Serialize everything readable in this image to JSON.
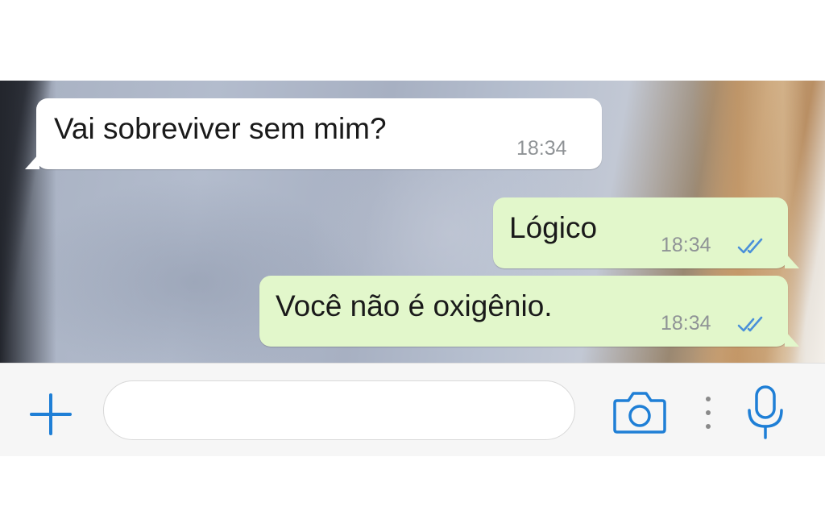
{
  "messages": [
    {
      "direction": "incoming",
      "text": "Vai sobreviver sem mim?",
      "time": "18:34"
    },
    {
      "direction": "outgoing",
      "text": "Lógico",
      "time": "18:34",
      "status": "read"
    },
    {
      "direction": "outgoing",
      "text": "Você não é oxigênio.",
      "time": "18:34",
      "status": "read"
    }
  ],
  "input_bar": {
    "message_placeholder": "",
    "message_value": "",
    "icons": [
      "plus-icon",
      "camera-icon",
      "more-dots-icon",
      "microphone-icon"
    ]
  },
  "colors": {
    "accent": "#1f7fd6",
    "incoming_bubble": "#ffffff",
    "outgoing_bubble": "#e2f7cb",
    "read_ticks": "#4a90d9",
    "timestamp": "#8f9396"
  }
}
